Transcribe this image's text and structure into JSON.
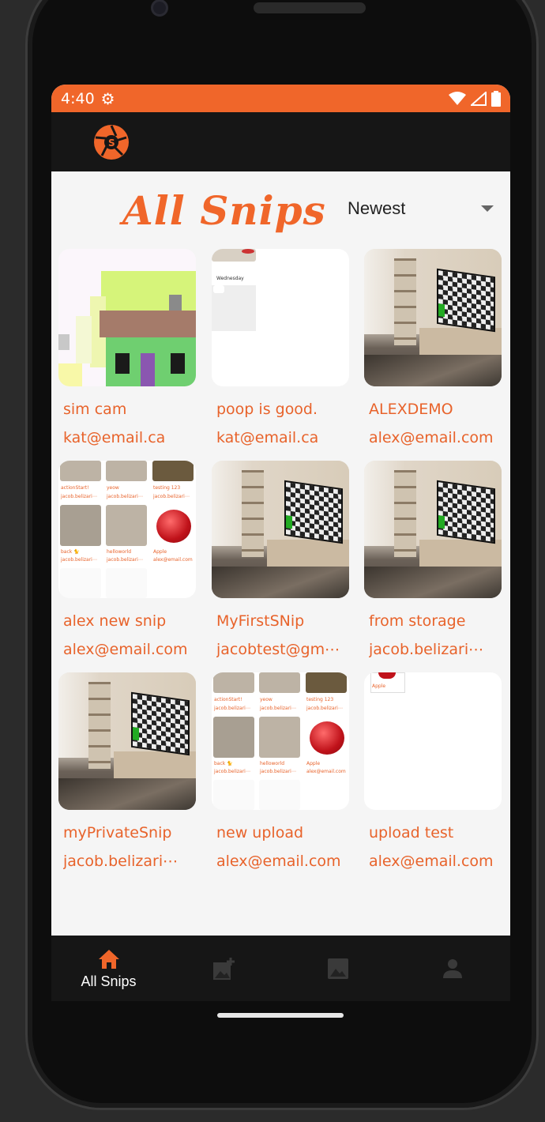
{
  "status": {
    "time": "4:40"
  },
  "header": {
    "title": "All Snips",
    "sort_selected": "Newest"
  },
  "snips": [
    {
      "title": "sim cam",
      "author": "kat@email.ca",
      "thumb": "pixel"
    },
    {
      "title": "poop is good.",
      "author": "kat@email.ca",
      "thumb": "calendar"
    },
    {
      "title": "ALEXDEMO",
      "author": "alex@email.com",
      "thumb": "room"
    },
    {
      "title": "alex new snip",
      "author": "alex@email.com",
      "thumb": "grid"
    },
    {
      "title": "MyFirstSNip",
      "author": "jacobtest@gm⋯",
      "thumb": "room"
    },
    {
      "title": "from storage",
      "author": "jacob.belizari⋯",
      "thumb": "room"
    },
    {
      "title": "myPrivateSnip",
      "author": "jacob.belizari⋯",
      "thumb": "room"
    },
    {
      "title": "new upload",
      "author": "alex@email.com",
      "thumb": "grid"
    },
    {
      "title": "upload test",
      "author": "alex@email.com",
      "thumb": "apple"
    }
  ],
  "mini_labels": {
    "calendar_day": "Wednesday",
    "grid_titles": [
      "actionStart!",
      "yeow",
      "testing 123",
      "back 🐈",
      "helloworld",
      "Apple"
    ],
    "grid_authors": [
      "jacob.belizari⋯",
      "jacob.belizari⋯",
      "jacob.belizari⋯",
      "jacob.belizari⋯",
      "jacob.belizari⋯",
      "alex@email.com"
    ],
    "apple_label": "Apple"
  },
  "nav": [
    {
      "label": "All Snips",
      "icon": "home-icon",
      "active": true
    },
    {
      "label": "",
      "icon": "add-photo-icon",
      "active": false
    },
    {
      "label": "",
      "icon": "image-icon",
      "active": false
    },
    {
      "label": "",
      "icon": "person-icon",
      "active": false
    }
  ],
  "colors": {
    "accent": "#f0662a",
    "bar": "#161616",
    "background": "#f5f5f5"
  }
}
